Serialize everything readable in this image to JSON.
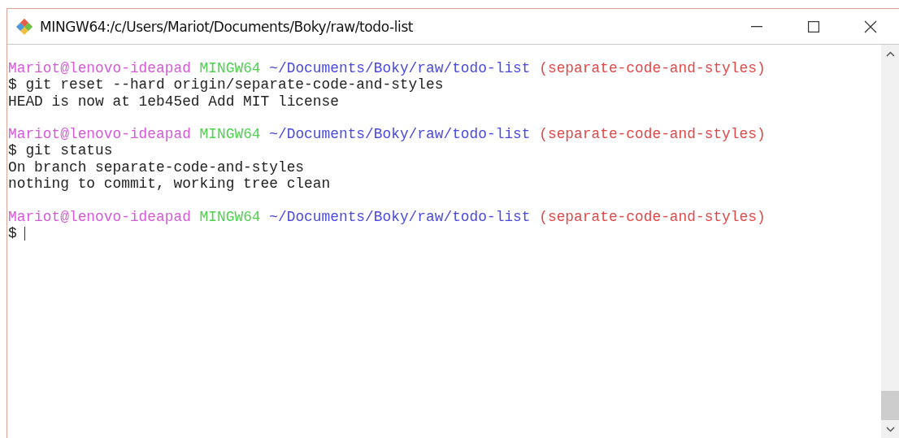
{
  "window": {
    "title": "MINGW64:/c/Users/Mariot/Documents/Boky/raw/todo-list"
  },
  "terminal": {
    "lines": [
      {
        "kind": "prompt",
        "user": "Mariot@lenovo-ideapad",
        "shell": "MINGW64",
        "path": "~/Documents/Boky/raw/todo-list",
        "branch": "(separate-code-and-styles)"
      },
      {
        "kind": "command",
        "text": "$ git reset --hard origin/separate-code-and-styles"
      },
      {
        "kind": "output",
        "text": "HEAD is now at 1eb45ed Add MIT license"
      },
      {
        "kind": "blank"
      },
      {
        "kind": "prompt",
        "user": "Mariot@lenovo-ideapad",
        "shell": "MINGW64",
        "path": "~/Documents/Boky/raw/todo-list",
        "branch": "(separate-code-and-styles)"
      },
      {
        "kind": "command",
        "text": "$ git status"
      },
      {
        "kind": "output",
        "text": "On branch separate-code-and-styles"
      },
      {
        "kind": "output",
        "text": "nothing to commit, working tree clean"
      },
      {
        "kind": "blank"
      },
      {
        "kind": "prompt",
        "user": "Mariot@lenovo-ideapad",
        "shell": "MINGW64",
        "path": "~/Documents/Boky/raw/todo-list",
        "branch": "(separate-code-and-styles)"
      },
      {
        "kind": "command",
        "text": "$",
        "cursor": true
      }
    ]
  }
}
